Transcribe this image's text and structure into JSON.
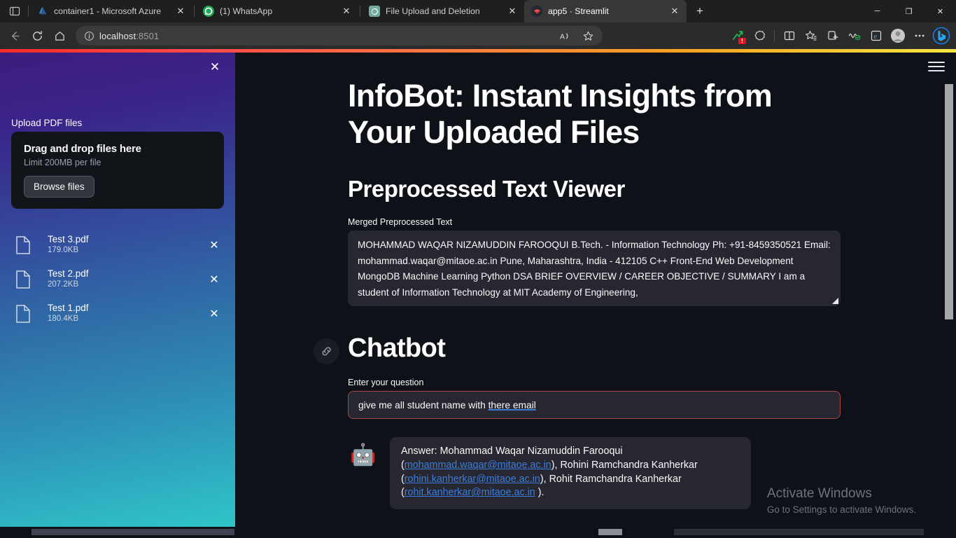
{
  "browser": {
    "tabs": [
      {
        "title": "container1 - Microsoft Azure",
        "favicon": "azure-icon",
        "active": false
      },
      {
        "title": "(1) WhatsApp",
        "favicon": "whatsapp-icon",
        "active": false
      },
      {
        "title": "File Upload and Deletion",
        "favicon": "openai-icon",
        "active": false
      },
      {
        "title": "app5 · Streamlit",
        "favicon": "streamlit-icon",
        "active": true
      }
    ],
    "new_tab_label": "+",
    "window_controls": {
      "minimize": "─",
      "maximize": "❐",
      "close": "✕"
    },
    "url": "localhost:8501",
    "url_host": "localhost",
    "url_port": ":8501",
    "toolbar_icons": [
      "back-icon",
      "refresh-icon",
      "home-icon",
      "info-icon",
      "read-aloud-icon",
      "favorite-star-icon",
      "shopping-icon",
      "browser-essentials-icon",
      "split-screen-icon",
      "collections-icon",
      "favorites-icon",
      "performance-icon",
      "ie-mode-icon",
      "profile-icon",
      "more-icon",
      "bing-copilot-icon"
    ],
    "extension_badge": "!"
  },
  "sidebar": {
    "close_label": "✕",
    "upload_label": "Upload PDF files",
    "dropzone": {
      "title": "Drag and drop files here",
      "limit": "Limit 200MB per file",
      "browse_label": "Browse files"
    },
    "files": [
      {
        "name": "Test 3.pdf",
        "size": "179.0KB",
        "remove": "✕"
      },
      {
        "name": "Test 2.pdf",
        "size": "207.2KB",
        "remove": "✕"
      },
      {
        "name": "Test 1.pdf",
        "size": "180.4KB",
        "remove": "✕"
      }
    ],
    "gradient_from": "#3d1d7d",
    "gradient_to": "#2fc5c9"
  },
  "main": {
    "menu_label": "☰",
    "page_title": "InfoBot: Instant Insights from Your Uploaded Files",
    "viewer": {
      "heading": "Preprocessed Text Viewer",
      "textarea_label": "Merged Preprocessed Text",
      "textarea_value": "MOHAMMAD WAQAR NIZAMUDDIN FAROOQUI B.Tech. - Information Technology Ph: +91-8459350521 Email: mohammad.waqar@mitaoe.ac.in Pune, Maharashtra, India - 412105 C++ Front-End Web Development MongoDB Machine Learning Python DSA BRIEF OVERVIEW / CAREER OBJECTIVE / SUMMARY I am a student of Information Technology at MIT Academy of Engineering,"
    },
    "chatbot": {
      "heading": "Chatbot",
      "anchor_icon": "link-icon",
      "question_label": "Enter your question",
      "question_value_before": "give me all student name with ",
      "question_value_misspelled": "there email",
      "avatar_icon": "robot-avatar-icon",
      "answer_prefix": "Answer: ",
      "answer_parts": [
        {
          "text": "Mohammad Waqar Nizamuddin Farooqui (",
          "type": "text"
        },
        {
          "text": "mohammad.waqar@mitaoe.ac.in",
          "type": "link"
        },
        {
          "text": "), Rohini Ramchandra Kanherkar (",
          "type": "text"
        },
        {
          "text": "rohini.kanherkar@mitaoe.ac.in",
          "type": "link"
        },
        {
          "text": "), Rohit Ramchandra Kanherkar (",
          "type": "text"
        },
        {
          "text": "rohit.kanherkar@mitaoe.ac.in",
          "type": "link"
        },
        {
          "text": " ).",
          "type": "text"
        }
      ],
      "link_color": "#3b7ddd"
    }
  },
  "watermark": {
    "line1": "Activate Windows",
    "line2": "Go to Settings to activate Windows."
  }
}
